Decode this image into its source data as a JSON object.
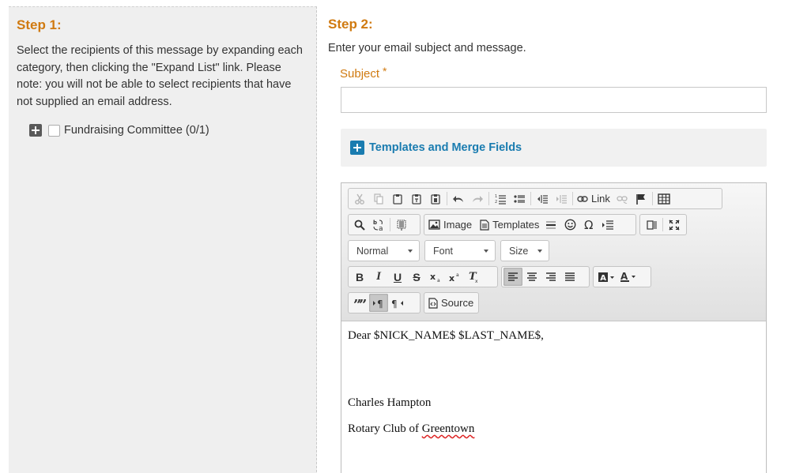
{
  "step1": {
    "title": "Step 1:",
    "instructions": "Select the recipients of this message by expanding each category, then clicking the \"Expand List\" link. Please note: you will not be able to select recipients that have not supplied an email address.",
    "categories": [
      {
        "label": "Fundraising Committee (0/1)"
      }
    ]
  },
  "step2": {
    "title": "Step 2:",
    "instructions": "Enter your email subject and message.",
    "subject_label": "Subject",
    "subject_required": "*",
    "subject_value": "",
    "templates_label": "Templates and Merge Fields"
  },
  "editor": {
    "toolbar": {
      "link_label": "Link",
      "image_label": "Image",
      "templates_label": "Templates",
      "source_label": "Source",
      "format_value": "Normal",
      "font_value": "Font",
      "size_value": "Size",
      "bold": "B",
      "italic": "I",
      "underline": "U",
      "strike": "S"
    },
    "body": {
      "greeting": "Dear $NICK_NAME$ $LAST_NAME$,",
      "signature_name": "Charles Hampton",
      "signature_org_prefix": "Rotary Club of ",
      "signature_org_misspelled": "Greentown"
    }
  },
  "colors": {
    "accent_orange": "#d07a10",
    "link_blue": "#1a7cb0",
    "panel_gray": "#efefef"
  }
}
